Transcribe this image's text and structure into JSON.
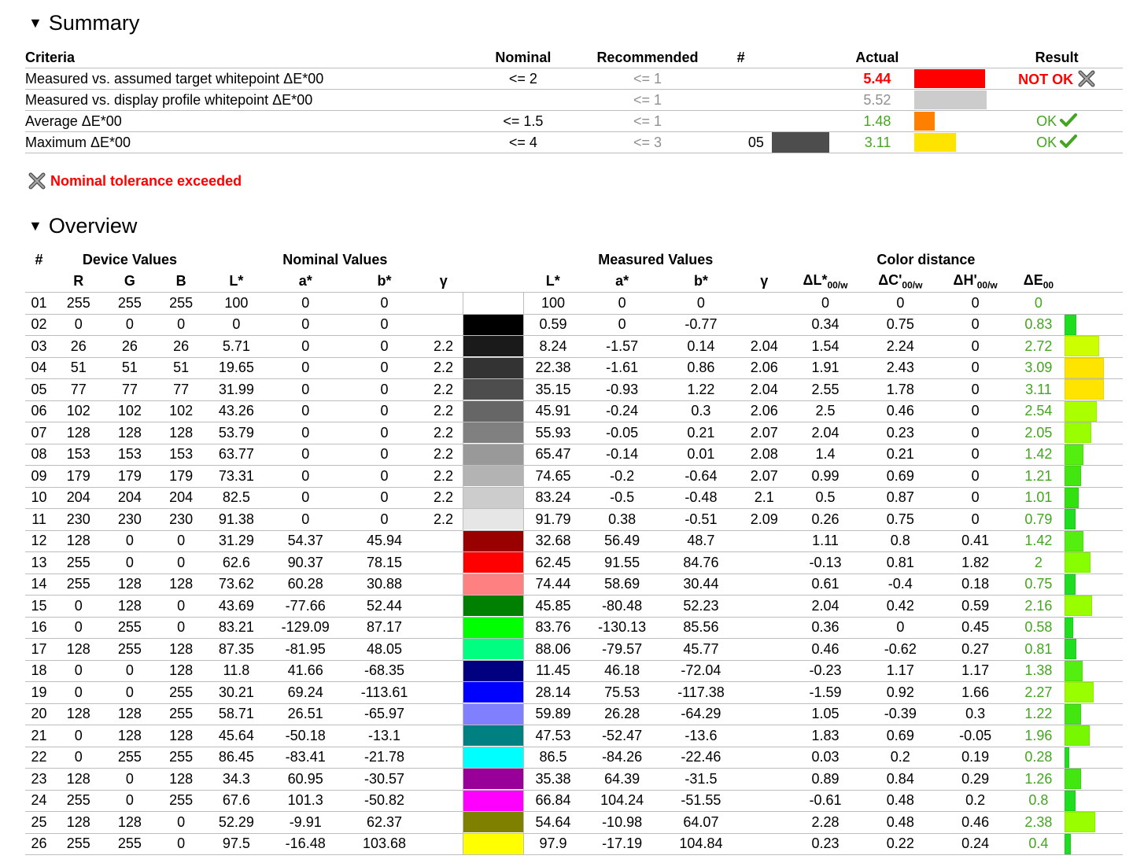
{
  "summary": {
    "title": "Summary",
    "headers": {
      "criteria": "Criteria",
      "nominal": "Nominal",
      "recommended": "Recommended",
      "hash": "#",
      "actual": "Actual",
      "result": "Result"
    },
    "rows": [
      {
        "criteria": "Measured vs. assumed target whitepoint ΔE*00",
        "nominal": "<= 2",
        "recommended": "<= 1",
        "hash": "",
        "actual": "5.44",
        "actual_color": "#ff0000",
        "bar_color": "#ff0000",
        "bar_fraction": 0.93,
        "result": "NOT OK",
        "result_status": "fail"
      },
      {
        "criteria": "Measured vs. display profile whitepoint ΔE*00",
        "nominal": "",
        "recommended": "<= 1",
        "hash": "",
        "actual": "5.52",
        "actual_color": "#909090",
        "bar_color": "#cccccc",
        "bar_fraction": 0.95,
        "result": "",
        "result_status": "none"
      },
      {
        "criteria": "Average ΔE*00",
        "nominal": "<= 1.5",
        "recommended": "<= 1",
        "hash": "",
        "actual": "1.48",
        "actual_color": "#44a520",
        "bar_color": "#ff8000",
        "bar_fraction": 0.26,
        "result": "OK",
        "result_status": "pass"
      },
      {
        "criteria": "Maximum ΔE*00",
        "nominal": "<= 4",
        "recommended": "<= 3",
        "hash": "05",
        "hash_swatch": [
          "#4d4d4d",
          "#4d4d4d"
        ],
        "actual": "3.11",
        "actual_color": "#44a520",
        "bar_color": "#ffe400",
        "bar_fraction": 0.54,
        "result": "OK",
        "result_status": "pass"
      }
    ],
    "tolerance_note": "Nominal tolerance exceeded"
  },
  "overview": {
    "title": "Overview",
    "group_headers": {
      "num": "#",
      "device": "Device Values",
      "nominal": "Nominal Values",
      "measured": "Measured Values",
      "distance": "Color distance"
    },
    "sub_headers": {
      "r": "R",
      "g": "G",
      "b": "B",
      "l": "L*",
      "a": "a*",
      "bb": "b*",
      "gamma": "γ",
      "ml": "L*",
      "ma": "a*",
      "mb": "b*",
      "mgamma": "γ",
      "dl": "ΔL*",
      "dl_sub": "00/w",
      "dc": "ΔC'",
      "dc_sub": "00/w",
      "dh": "ΔH'",
      "dh_sub": "00/w",
      "de": "ΔE",
      "de_sub": "00"
    },
    "rows": [
      {
        "n": "01",
        "r": "255",
        "g": "255",
        "b": "255",
        "l": "100",
        "a": "0",
        "bb": "0",
        "gamma": "",
        "color": "#ffffff",
        "ml": "100",
        "ma": "0",
        "mb": "0",
        "mg": "",
        "dl": "0",
        "dc": "0",
        "dh": "0",
        "de": "0",
        "bar": "",
        "barw": 0
      },
      {
        "n": "02",
        "r": "0",
        "g": "0",
        "b": "0",
        "l": "0",
        "a": "0",
        "bb": "0",
        "gamma": "",
        "color": "#000000",
        "ml": "0.59",
        "ma": "0",
        "mb": "-0.77",
        "mg": "",
        "dl": "0.34",
        "dc": "0.75",
        "dh": "0",
        "de": "0.83",
        "bar": "#1fdd1f",
        "barw": 0.83
      },
      {
        "n": "03",
        "r": "26",
        "g": "26",
        "b": "26",
        "l": "5.71",
        "a": "0",
        "bb": "0",
        "gamma": "2.2",
        "color": "#1a1a1a",
        "ml": "8.24",
        "ma": "-1.57",
        "mb": "0.14",
        "mg": "2.04",
        "dl": "1.54",
        "dc": "2.24",
        "dh": "0",
        "de": "2.72",
        "bar": "#ccff00",
        "barw": 2.72
      },
      {
        "n": "04",
        "r": "51",
        "g": "51",
        "b": "51",
        "l": "19.65",
        "a": "0",
        "bb": "0",
        "gamma": "2.2",
        "color": "#333333",
        "ml": "22.38",
        "ma": "-1.61",
        "mb": "0.86",
        "mg": "2.06",
        "dl": "1.91",
        "dc": "2.43",
        "dh": "0",
        "de": "3.09",
        "bar": "#ffe400",
        "barw": 3.09
      },
      {
        "n": "05",
        "r": "77",
        "g": "77",
        "b": "77",
        "l": "31.99",
        "a": "0",
        "bb": "0",
        "gamma": "2.2",
        "color": "#4d4d4d",
        "ml": "35.15",
        "ma": "-0.93",
        "mb": "1.22",
        "mg": "2.04",
        "dl": "2.55",
        "dc": "1.78",
        "dh": "0",
        "de": "3.11",
        "bar": "#ffe400",
        "barw": 3.11
      },
      {
        "n": "06",
        "r": "102",
        "g": "102",
        "b": "102",
        "l": "43.26",
        "a": "0",
        "bb": "0",
        "gamma": "2.2",
        "color": "#666666",
        "ml": "45.91",
        "ma": "-0.24",
        "mb": "0.3",
        "mg": "2.06",
        "dl": "2.5",
        "dc": "0.46",
        "dh": "0",
        "de": "2.54",
        "bar": "#aaff00",
        "barw": 2.54
      },
      {
        "n": "07",
        "r": "128",
        "g": "128",
        "b": "128",
        "l": "53.79",
        "a": "0",
        "bb": "0",
        "gamma": "2.2",
        "color": "#808080",
        "ml": "55.93",
        "ma": "-0.05",
        "mb": "0.21",
        "mg": "2.07",
        "dl": "2.04",
        "dc": "0.23",
        "dh": "0",
        "de": "2.05",
        "bar": "#99ff00",
        "barw": 2.05
      },
      {
        "n": "08",
        "r": "153",
        "g": "153",
        "b": "153",
        "l": "63.77",
        "a": "0",
        "bb": "0",
        "gamma": "2.2",
        "color": "#999999",
        "ml": "65.47",
        "ma": "-0.14",
        "mb": "0.01",
        "mg": "2.08",
        "dl": "1.4",
        "dc": "0.21",
        "dh": "0",
        "de": "1.42",
        "bar": "#55ee11",
        "barw": 1.42
      },
      {
        "n": "09",
        "r": "179",
        "g": "179",
        "b": "179",
        "l": "73.31",
        "a": "0",
        "bb": "0",
        "gamma": "2.2",
        "color": "#b3b3b3",
        "ml": "74.65",
        "ma": "-0.2",
        "mb": "-0.64",
        "mg": "2.07",
        "dl": "0.99",
        "dc": "0.69",
        "dh": "0",
        "de": "1.21",
        "bar": "#44e611",
        "barw": 1.21
      },
      {
        "n": "10",
        "r": "204",
        "g": "204",
        "b": "204",
        "l": "82.5",
        "a": "0",
        "bb": "0",
        "gamma": "2.2",
        "color": "#cccccc",
        "ml": "83.24",
        "ma": "-0.5",
        "mb": "-0.48",
        "mg": "2.1",
        "dl": "0.5",
        "dc": "0.87",
        "dh": "0",
        "de": "1.01",
        "bar": "#33e111",
        "barw": 1.01
      },
      {
        "n": "11",
        "r": "230",
        "g": "230",
        "b": "230",
        "l": "91.38",
        "a": "0",
        "bb": "0",
        "gamma": "2.2",
        "color": "#e6e6e6",
        "ml": "91.79",
        "ma": "0.38",
        "mb": "-0.51",
        "mg": "2.09",
        "dl": "0.26",
        "dc": "0.75",
        "dh": "0",
        "de": "0.79",
        "bar": "#1fdd1f",
        "barw": 0.79
      },
      {
        "n": "12",
        "r": "128",
        "g": "0",
        "b": "0",
        "l": "31.29",
        "a": "54.37",
        "bb": "45.94",
        "gamma": "",
        "color": "#990000",
        "ml": "32.68",
        "ma": "56.49",
        "mb": "48.7",
        "mg": "",
        "dl": "1.11",
        "dc": "0.8",
        "dh": "0.41",
        "de": "1.42",
        "bar": "#55ee11",
        "barw": 1.42
      },
      {
        "n": "13",
        "r": "255",
        "g": "0",
        "b": "0",
        "l": "62.6",
        "a": "90.37",
        "bb": "78.15",
        "gamma": "",
        "color": "#ff0000",
        "ml": "62.45",
        "ma": "91.55",
        "mb": "84.76",
        "mg": "",
        "dl": "-0.13",
        "dc": "0.81",
        "dh": "1.82",
        "de": "2",
        "bar": "#88ff00",
        "barw": 2.0
      },
      {
        "n": "14",
        "r": "255",
        "g": "128",
        "b": "128",
        "l": "73.62",
        "a": "60.28",
        "bb": "30.88",
        "gamma": "",
        "color": "#ff8080",
        "ml": "74.44",
        "ma": "58.69",
        "mb": "30.44",
        "mg": "",
        "dl": "0.61",
        "dc": "-0.4",
        "dh": "0.18",
        "de": "0.75",
        "bar": "#1fdd1f",
        "barw": 0.75
      },
      {
        "n": "15",
        "r": "0",
        "g": "128",
        "b": "0",
        "l": "43.69",
        "a": "-77.66",
        "bb": "52.44",
        "gamma": "",
        "color": "#008000",
        "ml": "45.85",
        "ma": "-80.48",
        "mb": "52.23",
        "mg": "",
        "dl": "2.04",
        "dc": "0.42",
        "dh": "0.59",
        "de": "2.16",
        "bar": "#99ff00",
        "barw": 2.16
      },
      {
        "n": "16",
        "r": "0",
        "g": "255",
        "b": "0",
        "l": "83.21",
        "a": "-129.09",
        "bb": "87.17",
        "gamma": "",
        "color": "#00ff00",
        "ml": "83.76",
        "ma": "-130.13",
        "mb": "85.56",
        "mg": "",
        "dl": "0.36",
        "dc": "0",
        "dh": "0.45",
        "de": "0.58",
        "bar": "#1fdd1f",
        "barw": 0.58
      },
      {
        "n": "17",
        "r": "128",
        "g": "255",
        "b": "128",
        "l": "87.35",
        "a": "-81.95",
        "bb": "48.05",
        "gamma": "",
        "color": "#00ff80",
        "ml": "88.06",
        "ma": "-79.57",
        "mb": "45.77",
        "mg": "",
        "dl": "0.46",
        "dc": "-0.62",
        "dh": "0.27",
        "de": "0.81",
        "bar": "#1fdd1f",
        "barw": 0.81
      },
      {
        "n": "18",
        "r": "0",
        "g": "0",
        "b": "128",
        "l": "11.8",
        "a": "41.66",
        "bb": "-68.35",
        "gamma": "",
        "color": "#000080",
        "ml": "11.45",
        "ma": "46.18",
        "mb": "-72.04",
        "mg": "",
        "dl": "-0.23",
        "dc": "1.17",
        "dh": "1.17",
        "de": "1.38",
        "bar": "#55ee11",
        "barw": 1.38
      },
      {
        "n": "19",
        "r": "0",
        "g": "0",
        "b": "255",
        "l": "30.21",
        "a": "69.24",
        "bb": "-113.61",
        "gamma": "",
        "color": "#0000ff",
        "ml": "28.14",
        "ma": "75.53",
        "mb": "-117.38",
        "mg": "",
        "dl": "-1.59",
        "dc": "0.92",
        "dh": "1.66",
        "de": "2.27",
        "bar": "#99ff00",
        "barw": 2.27
      },
      {
        "n": "20",
        "r": "128",
        "g": "128",
        "b": "255",
        "l": "58.71",
        "a": "26.51",
        "bb": "-65.97",
        "gamma": "",
        "color": "#8080ff",
        "ml": "59.89",
        "ma": "26.28",
        "mb": "-64.29",
        "mg": "",
        "dl": "1.05",
        "dc": "-0.39",
        "dh": "0.3",
        "de": "1.22",
        "bar": "#44e611",
        "barw": 1.22
      },
      {
        "n": "21",
        "r": "0",
        "g": "128",
        "b": "128",
        "l": "45.64",
        "a": "-50.18",
        "bb": "-13.1",
        "gamma": "",
        "color": "#008080",
        "ml": "47.53",
        "ma": "-52.47",
        "mb": "-13.6",
        "mg": "",
        "dl": "1.83",
        "dc": "0.69",
        "dh": "-0.05",
        "de": "1.96",
        "bar": "#77f700",
        "barw": 1.96
      },
      {
        "n": "22",
        "r": "0",
        "g": "255",
        "b": "255",
        "l": "86.45",
        "a": "-83.41",
        "bb": "-21.78",
        "gamma": "",
        "color": "#00ffff",
        "ml": "86.5",
        "ma": "-84.26",
        "mb": "-22.46",
        "mg": "",
        "dl": "0.03",
        "dc": "0.2",
        "dh": "0.19",
        "de": "0.28",
        "bar": "#1fdd1f",
        "barw": 0.28
      },
      {
        "n": "23",
        "r": "128",
        "g": "0",
        "b": "128",
        "l": "34.3",
        "a": "60.95",
        "bb": "-30.57",
        "gamma": "",
        "color": "#990099",
        "ml": "35.38",
        "ma": "64.39",
        "mb": "-31.5",
        "mg": "",
        "dl": "0.89",
        "dc": "0.84",
        "dh": "0.29",
        "de": "1.26",
        "bar": "#44e611",
        "barw": 1.26
      },
      {
        "n": "24",
        "r": "255",
        "g": "0",
        "b": "255",
        "l": "67.6",
        "a": "101.3",
        "bb": "-50.82",
        "gamma": "",
        "color": "#ff00ff",
        "ml": "66.84",
        "ma": "104.24",
        "mb": "-51.55",
        "mg": "",
        "dl": "-0.61",
        "dc": "0.48",
        "dh": "0.2",
        "de": "0.8",
        "bar": "#1fdd1f",
        "barw": 0.8
      },
      {
        "n": "25",
        "r": "128",
        "g": "128",
        "b": "0",
        "l": "52.29",
        "a": "-9.91",
        "bb": "62.37",
        "gamma": "",
        "color": "#808000",
        "ml": "54.64",
        "ma": "-10.98",
        "mb": "64.07",
        "mg": "",
        "dl": "2.28",
        "dc": "0.48",
        "dh": "0.46",
        "de": "2.38",
        "bar": "#99ff00",
        "barw": 2.38
      },
      {
        "n": "26",
        "r": "255",
        "g": "255",
        "b": "0",
        "l": "97.5",
        "a": "-16.48",
        "bb": "103.68",
        "gamma": "",
        "color": "#ffff00",
        "ml": "97.9",
        "ma": "-17.19",
        "mb": "104.84",
        "mg": "",
        "dl": "0.23",
        "dc": "0.22",
        "dh": "0.24",
        "de": "0.4",
        "bar": "#1fdd1f",
        "barw": 0.4
      }
    ]
  }
}
